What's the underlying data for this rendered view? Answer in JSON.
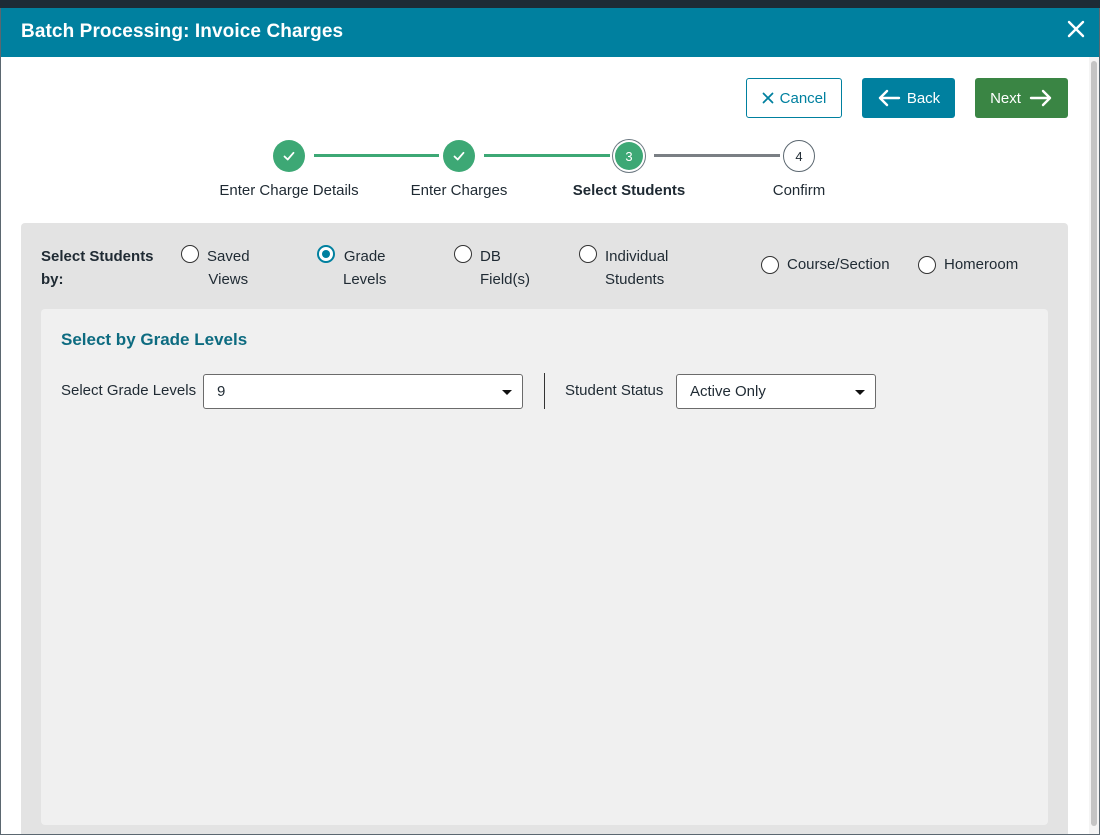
{
  "dialog": {
    "title": "Batch Processing: Invoice Charges",
    "close_icon": "close-icon"
  },
  "toolbar": {
    "cancel_label": "Cancel",
    "back_label": "Back",
    "next_label": "Next"
  },
  "stepper": {
    "steps": [
      {
        "label": "Enter Charge Details",
        "state": "done",
        "marker": ""
      },
      {
        "label": "Enter Charges",
        "state": "done",
        "marker": ""
      },
      {
        "label": "Select Students",
        "state": "current",
        "marker": "3"
      },
      {
        "label": "Confirm",
        "state": "todo",
        "marker": "4"
      }
    ]
  },
  "select_by": {
    "label_line1": "Select Students",
    "label_line2": "by:",
    "options": [
      {
        "line1": "Saved",
        "line2": "Views",
        "checked": false
      },
      {
        "line1": "Grade",
        "line2": "Levels",
        "checked": true
      },
      {
        "line1": "DB",
        "line2": "Field(s)",
        "checked": false
      },
      {
        "line1": "Individual",
        "line2": "Students",
        "checked": false
      },
      {
        "line1": "Course/Section",
        "line2": "",
        "checked": false
      },
      {
        "line1": "Homeroom",
        "line2": "",
        "checked": false
      }
    ]
  },
  "grade_panel": {
    "title": "Select by Grade Levels",
    "grade_label": "Select Grade Levels",
    "grade_value": "9",
    "status_label": "Student Status",
    "status_value": "Active Only"
  },
  "colors": {
    "header": "#00809f",
    "next_button": "#3a8544",
    "step_done": "#3da875",
    "panel_bg": "#e3e3e3"
  }
}
